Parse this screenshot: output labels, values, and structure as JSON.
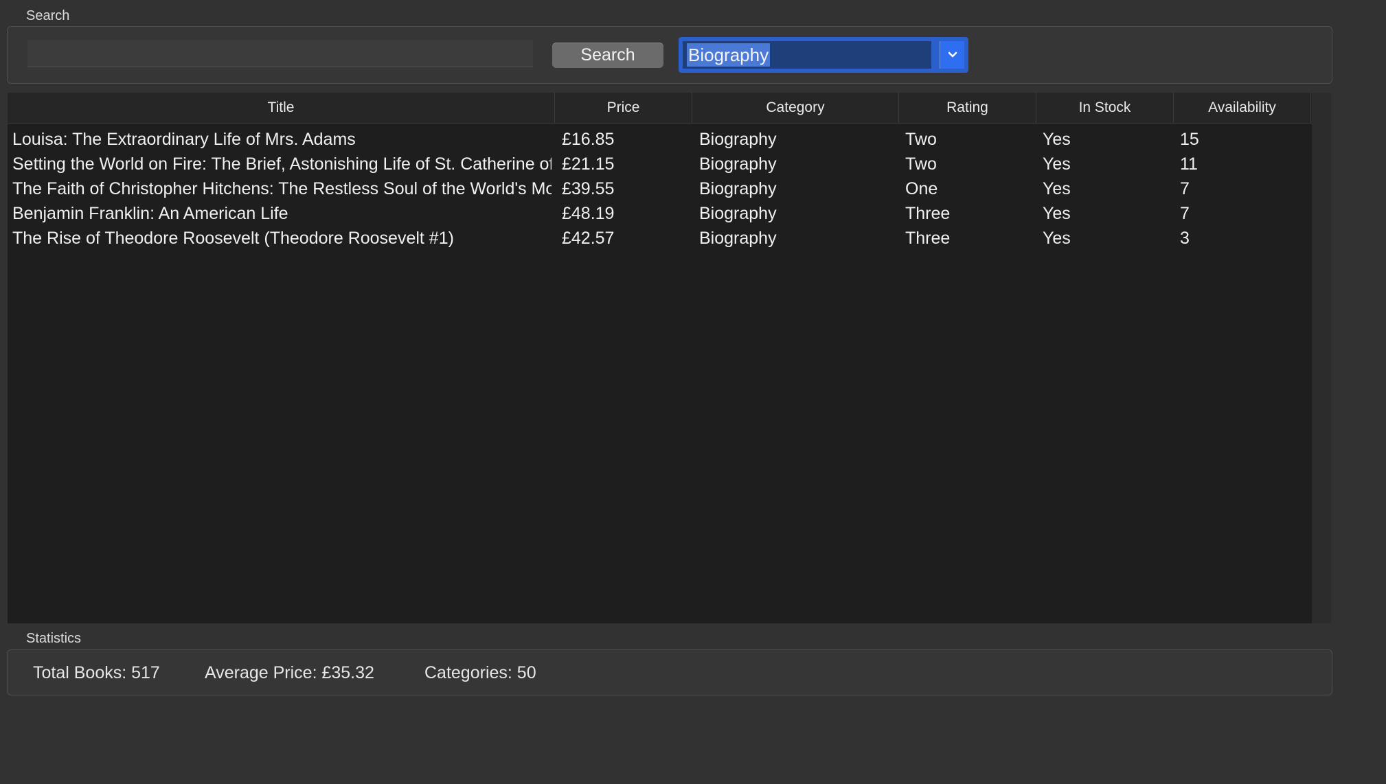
{
  "search_group": {
    "label": "Search",
    "input_value": "",
    "input_placeholder": "",
    "search_button_label": "Search",
    "category_selected": "Biography"
  },
  "table": {
    "columns": [
      "Title",
      "Price",
      "Category",
      "Rating",
      "In Stock",
      "Availability"
    ],
    "rows": [
      {
        "title": "Louisa: The Extraordinary Life of Mrs. Adams",
        "price": "£16.85",
        "category": "Biography",
        "rating": "Two",
        "in_stock": "Yes",
        "availability": "15"
      },
      {
        "title": "Setting the World on Fire: The Brief, Astonishing Life of St. Catherine of Siena",
        "price": "£21.15",
        "category": "Biography",
        "rating": "Two",
        "in_stock": "Yes",
        "availability": "11"
      },
      {
        "title": "The Faith of Christopher Hitchens: The Restless Soul of the World's Most Notorious Atheist",
        "price": "£39.55",
        "category": "Biography",
        "rating": "One",
        "in_stock": "Yes",
        "availability": "7"
      },
      {
        "title": "Benjamin Franklin: An American Life",
        "price": "£48.19",
        "category": "Biography",
        "rating": "Three",
        "in_stock": "Yes",
        "availability": "7"
      },
      {
        "title": "The Rise of Theodore Roosevelt (Theodore Roosevelt #1)",
        "price": "£42.57",
        "category": "Biography",
        "rating": "Three",
        "in_stock": "Yes",
        "availability": "3"
      }
    ]
  },
  "statistics": {
    "label": "Statistics",
    "total_books": "Total Books: 517",
    "average_price": "Average Price: £35.32",
    "categories": "Categories: 50"
  },
  "colors": {
    "background": "#323232",
    "table_background": "#1e1e1e",
    "accent": "#2a5fcc"
  },
  "icons": {
    "combo_arrow": "chevron-down-icon"
  }
}
